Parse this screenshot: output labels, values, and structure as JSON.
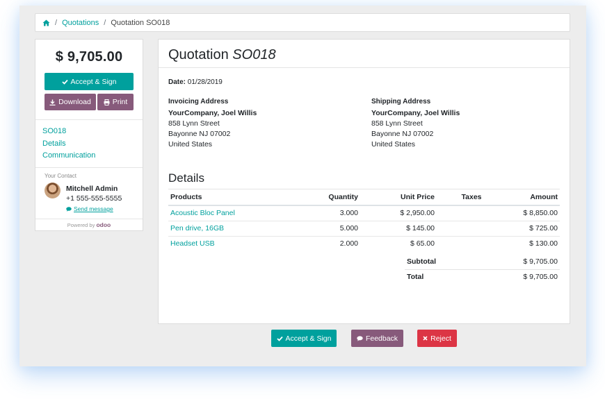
{
  "breadcrumb": {
    "home_icon": "home-icon",
    "items": [
      "Quotations"
    ],
    "current": "Quotation SO018",
    "separator": "/"
  },
  "sidebar": {
    "total": "$ 9,705.00",
    "accept_label": "Accept & Sign",
    "download_label": "Download",
    "print_label": "Print",
    "nav": [
      "SO018",
      "Details",
      "Communication"
    ],
    "contact_label": "Your Contact",
    "contact_name": "Mitchell Admin",
    "contact_phone": "+1 555-555-5555",
    "send_message_label": "Send message",
    "powered_by": "Powered by",
    "powered_brand": "odoo"
  },
  "document": {
    "title_prefix": "Quotation",
    "title_number": "SO018",
    "date_label": "Date:",
    "date_value": "01/28/2019",
    "invoicing": {
      "heading": "Invoicing Address",
      "name": "YourCompany, Joel Willis",
      "street": "858 Lynn Street",
      "city": "Bayonne NJ 07002",
      "country": "United States"
    },
    "shipping": {
      "heading": "Shipping Address",
      "name": "YourCompany, Joel Willis",
      "street": "858 Lynn Street",
      "city": "Bayonne NJ 07002",
      "country": "United States"
    },
    "details_heading": "Details",
    "columns": [
      "Products",
      "Quantity",
      "Unit Price",
      "Taxes",
      "Amount"
    ],
    "lines": [
      {
        "product": "Acoustic Bloc Panel",
        "quantity": "3.000",
        "unit_price": "$ 2,950.00",
        "taxes": "",
        "amount": "$ 8,850.00"
      },
      {
        "product": "Pen drive, 16GB",
        "quantity": "5.000",
        "unit_price": "$ 145.00",
        "taxes": "",
        "amount": "$ 725.00"
      },
      {
        "product": "Headset USB",
        "quantity": "2.000",
        "unit_price": "$ 65.00",
        "taxes": "",
        "amount": "$ 130.00"
      }
    ],
    "subtotal_label": "Subtotal",
    "subtotal_value": "$ 9,705.00",
    "total_label": "Total",
    "total_value": "$ 9,705.00"
  },
  "actions": {
    "accept_label": "Accept & Sign",
    "feedback_label": "Feedback",
    "reject_label": "Reject"
  },
  "colors": {
    "accent": "#00A09D",
    "purple": "#875A7B",
    "danger": "#DC3545"
  }
}
